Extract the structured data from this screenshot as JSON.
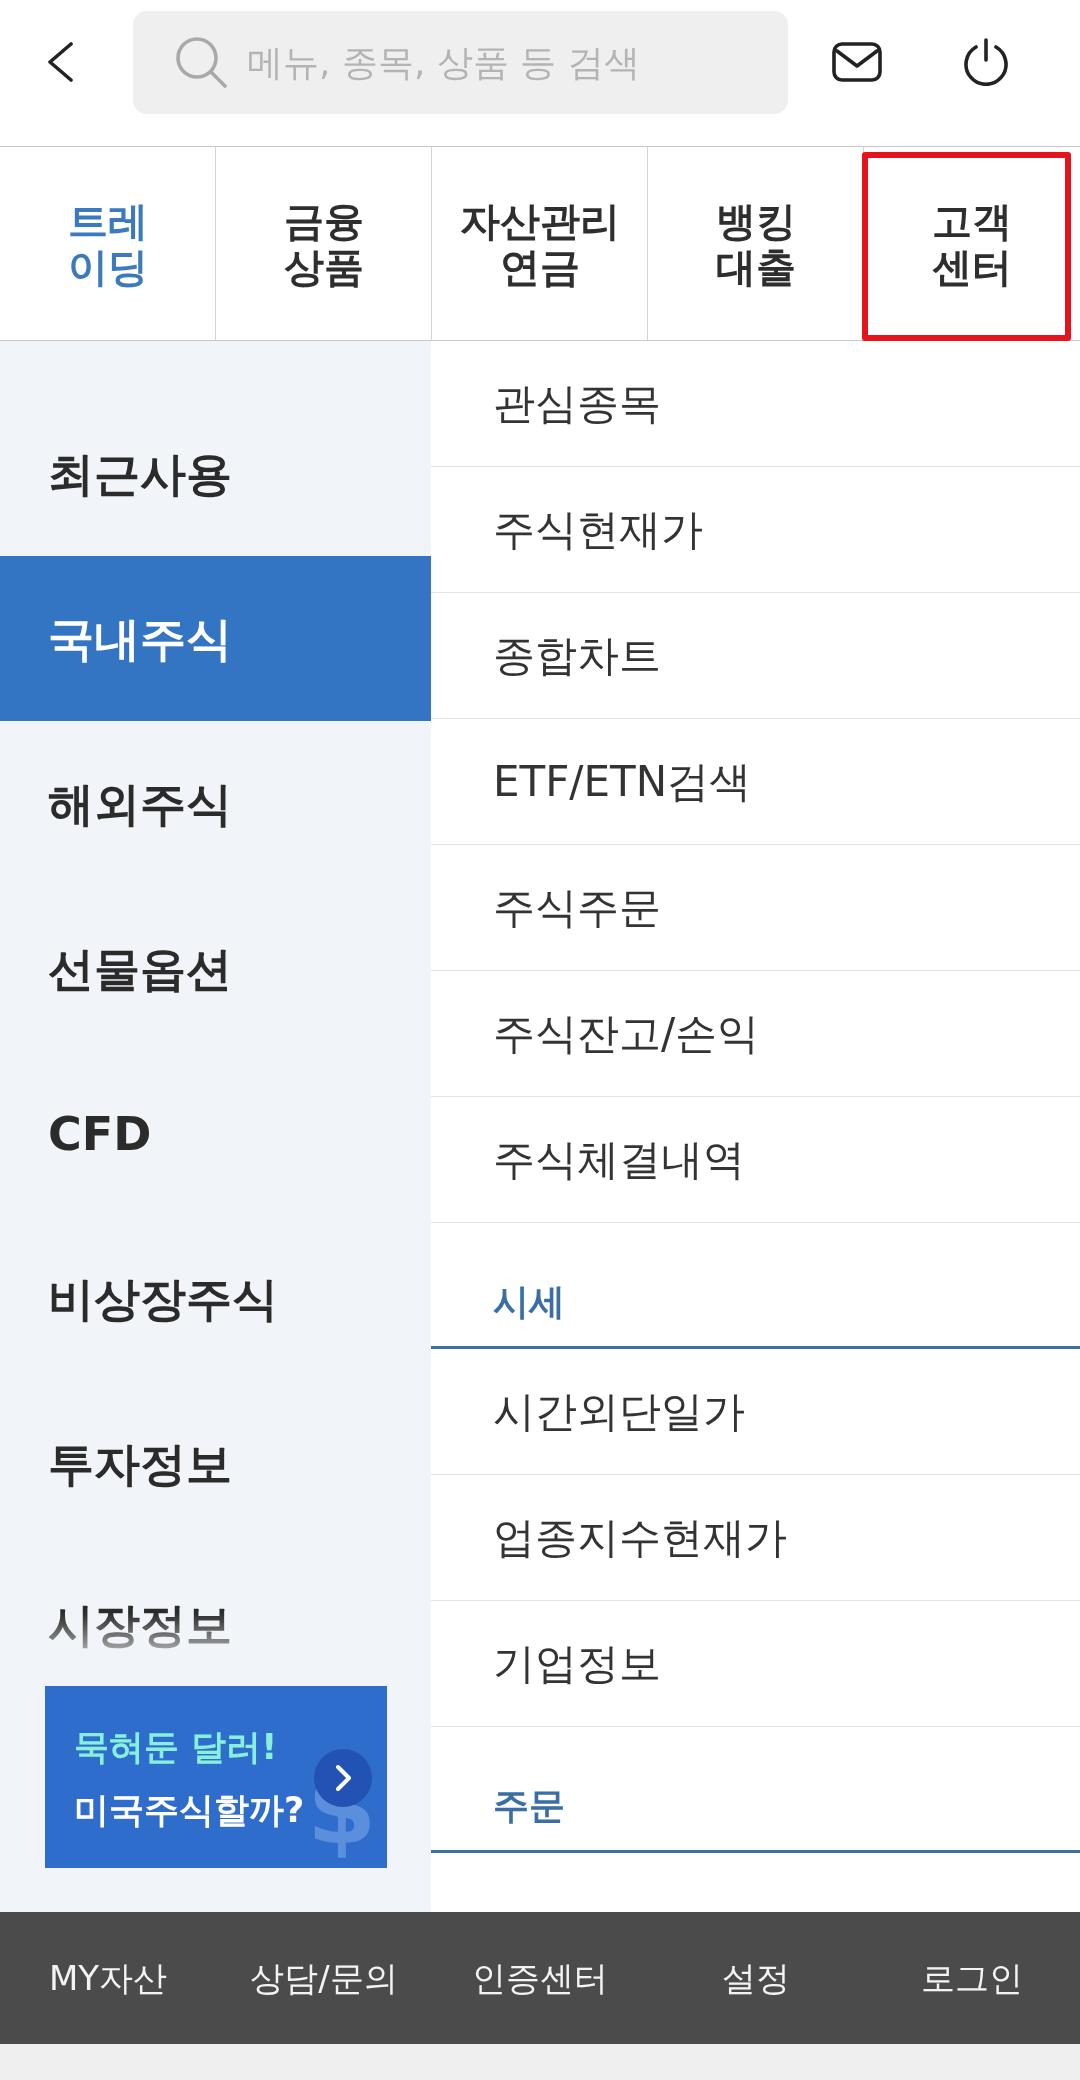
{
  "header": {
    "search": {
      "placeholder": "메뉴, 종목, 상품 등 검색"
    }
  },
  "tabs": [
    {
      "label": "트레\n이딩",
      "selected": true,
      "highlighted": false
    },
    {
      "label": "금융\n상품",
      "selected": false,
      "highlighted": false
    },
    {
      "label": "자산관리\n연금",
      "selected": false,
      "highlighted": false
    },
    {
      "label": "뱅킹\n대출",
      "selected": false,
      "highlighted": false
    },
    {
      "label": "고객\n센터",
      "selected": false,
      "highlighted": true
    }
  ],
  "sidebar": {
    "items": [
      {
        "label": "최근사용",
        "selected": false
      },
      {
        "label": "국내주식",
        "selected": true
      },
      {
        "label": "해외주식",
        "selected": false
      },
      {
        "label": "선물옵션",
        "selected": false
      },
      {
        "label": "CFD",
        "selected": false
      },
      {
        "label": "비상장주식",
        "selected": false
      },
      {
        "label": "투자정보",
        "selected": false
      },
      {
        "label": "시장정보",
        "selected": false
      }
    ],
    "banner": {
      "headline": "묵혀둔 달러!",
      "subline": "미국주식할까?",
      "symbol": "$"
    }
  },
  "menu": {
    "items": [
      {
        "kind": "link",
        "label": "관심종목"
      },
      {
        "kind": "link",
        "label": "주식현재가"
      },
      {
        "kind": "link",
        "label": "종합차트"
      },
      {
        "kind": "link",
        "label": "ETF/ETN검색"
      },
      {
        "kind": "link",
        "label": "주식주문"
      },
      {
        "kind": "link",
        "label": "주식잔고/손익"
      },
      {
        "kind": "link",
        "label": "주식체결내역"
      },
      {
        "kind": "section",
        "label": "시세"
      },
      {
        "kind": "link",
        "label": "시간외단일가"
      },
      {
        "kind": "link",
        "label": "업종지수현재가"
      },
      {
        "kind": "link",
        "label": "기업정보"
      },
      {
        "kind": "section",
        "label": "주문"
      }
    ]
  },
  "bottom_nav": [
    "MY자산",
    "상담/문의",
    "인증센터",
    "설정",
    "로그인"
  ]
}
